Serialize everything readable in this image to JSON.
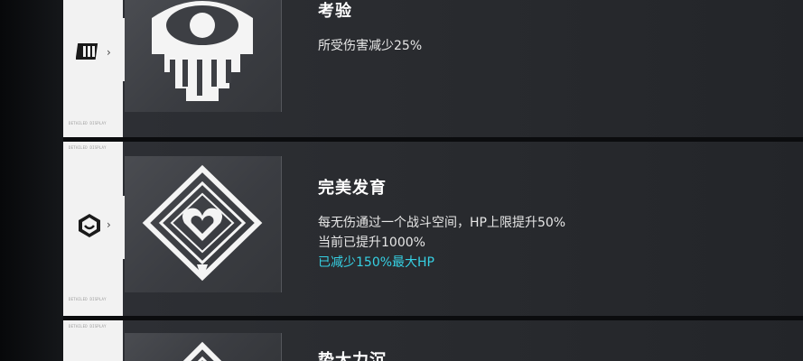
{
  "cards": [
    {
      "title": "考验",
      "lines": [
        "所受伤害减少25%"
      ],
      "side_tag": "DETAILED DISPLAY",
      "side_icon": "books-icon",
      "art_icon": "eye-emblem-icon"
    },
    {
      "title": "完美发育",
      "lines": [
        "每无伤通过一个战斗空间，HP上限提升50%",
        "当前已提升1000%"
      ],
      "highlight": "已减少150%最大HP",
      "side_tag": "DETAILED DISPLAY",
      "side_icon": "hexagon-smile-icon",
      "art_icon": "diamond-heart-emblem-icon"
    },
    {
      "title": "势大力沉",
      "lines": [],
      "side_tag": "DETAILED DISPLAY",
      "side_icon": "emblem-icon",
      "art_icon": "diamond-emblem-icon"
    }
  ],
  "colors": {
    "highlight": "#36d0e3",
    "card_bg": "#2e3035",
    "side_bg": "#f2f2f2"
  }
}
